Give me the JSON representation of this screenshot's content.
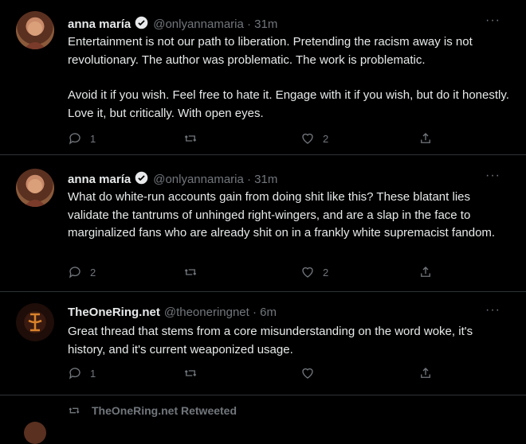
{
  "tweets": [
    {
      "name": "anna maría",
      "handle": "@onlyannamaria · 31m",
      "paragraphs": [
        "Entertainment is not our path to liberation. Pretending the racism away is not revolutionary. The author was problematic. The work is problematic.",
        "Avoid it if you wish. Feel free to hate it. Engage with it if you wish, but do it honestly. Love it, but critically. With open eyes."
      ],
      "replies": "1",
      "retweets": "",
      "likes": "2"
    },
    {
      "name": "anna maría",
      "handle": "@onlyannamaria · 31m",
      "paragraphs": [
        "What do white-run accounts gain from doing shit like this? These blatant lies validate the tantrums of unhinged right-wingers, and are a slap in the face to marginalized fans who are already shit on in a frankly white supremacist fandom."
      ],
      "replies": "2",
      "retweets": "",
      "likes": "2"
    },
    {
      "name": "TheOneRing.net",
      "handle": "@theoneringnet · 6m",
      "paragraphs": [
        "Great thread that stems from a core misunderstanding on the word woke, it's history, and it's current weaponized usage."
      ],
      "replies": "1",
      "retweets": "",
      "likes": ""
    }
  ],
  "retweet_note": "TheOneRing.net Retweeted",
  "more_label": "···"
}
